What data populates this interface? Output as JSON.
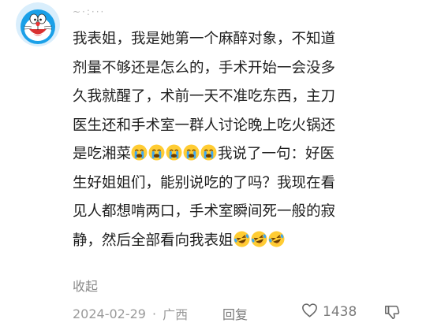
{
  "comment": {
    "username": "~·:···",
    "lines": [
      "我表姐，我是她第一个麻醉对象，不知道",
      "剂量不够还是怎么的，手术开始一会没多",
      "久我就醒了，术前一天不准吃东西，主刀",
      "医生还和手术室一群人讨论晚上吃火锅还",
      "是吃湘菜",
      "我说了一句：好医",
      "生好姐姐们，能别说吃的了吗？我现在看",
      "见人都想啃两口，手术室瞬间死一般的寂",
      "静，然后全部看向我表姐"
    ],
    "collapse_label": "收起",
    "date": "2024-02-29",
    "location": "广西",
    "separator": "·",
    "reply_label": "回复",
    "like_count": "1438",
    "emoji_crying": "crying-emoji",
    "emoji_laughing": "laughing-emoji"
  }
}
